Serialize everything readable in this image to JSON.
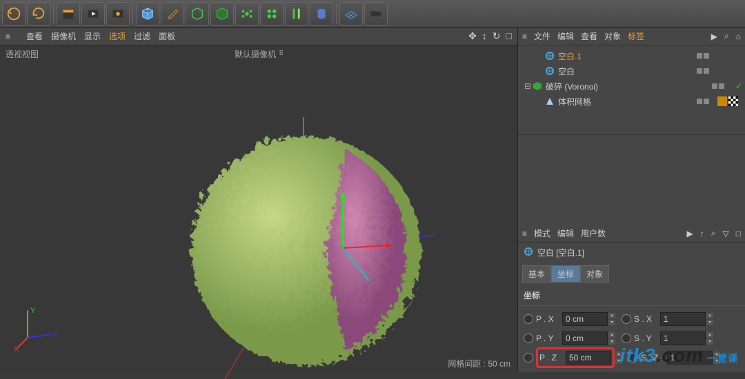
{
  "toolbar": {
    "icons": [
      "undo",
      "redo",
      "clapper",
      "play",
      "gear",
      "cube",
      "pen",
      "wirecube",
      "polycube",
      "atom",
      "cloner",
      "align",
      "bend",
      "floor",
      "camera"
    ]
  },
  "viewport": {
    "menus": [
      "查看",
      "摄像机",
      "显示",
      "选项",
      "过滤",
      "面板"
    ],
    "active_menu": "选项",
    "label": "透视视图",
    "camera": "默认摄像机",
    "footer": "网格间距 : 50 cm"
  },
  "object_manager": {
    "menus": [
      "文件",
      "编辑",
      "查看",
      "对象",
      "标签"
    ],
    "active_menu": "标签",
    "items": [
      {
        "name": "空白.1",
        "icon": "null",
        "active": true,
        "indent": 1
      },
      {
        "name": "空白",
        "icon": "null",
        "active": false,
        "indent": 1
      },
      {
        "name": "破碎 (Voronoi)",
        "icon": "fracture",
        "active": false,
        "indent": 0,
        "expandable": true,
        "check": true
      },
      {
        "name": "体积网格",
        "icon": "volume",
        "active": false,
        "indent": 1,
        "tags": true
      }
    ]
  },
  "attributes": {
    "menus": [
      "模式",
      "编辑",
      "用户数"
    ],
    "title": "空白 [空白.1]",
    "tabs": [
      "基本",
      "坐标",
      "对象"
    ],
    "active_tab": "坐标",
    "section": "坐标",
    "rows": [
      {
        "l1": "P . X",
        "v1": "0 cm",
        "l2": "S . X",
        "v2": "1"
      },
      {
        "l1": "P . Y",
        "v1": "0 cm",
        "l2": "S . Y",
        "v2": "1"
      },
      {
        "l1": "P . Z",
        "v1": "50 cm",
        "l2": "S . Z",
        "v2": "1",
        "highlight": true
      }
    ]
  },
  "watermark": {
    "t1": "itk3",
    "t2": ".com",
    "t3": " 一堂课"
  }
}
